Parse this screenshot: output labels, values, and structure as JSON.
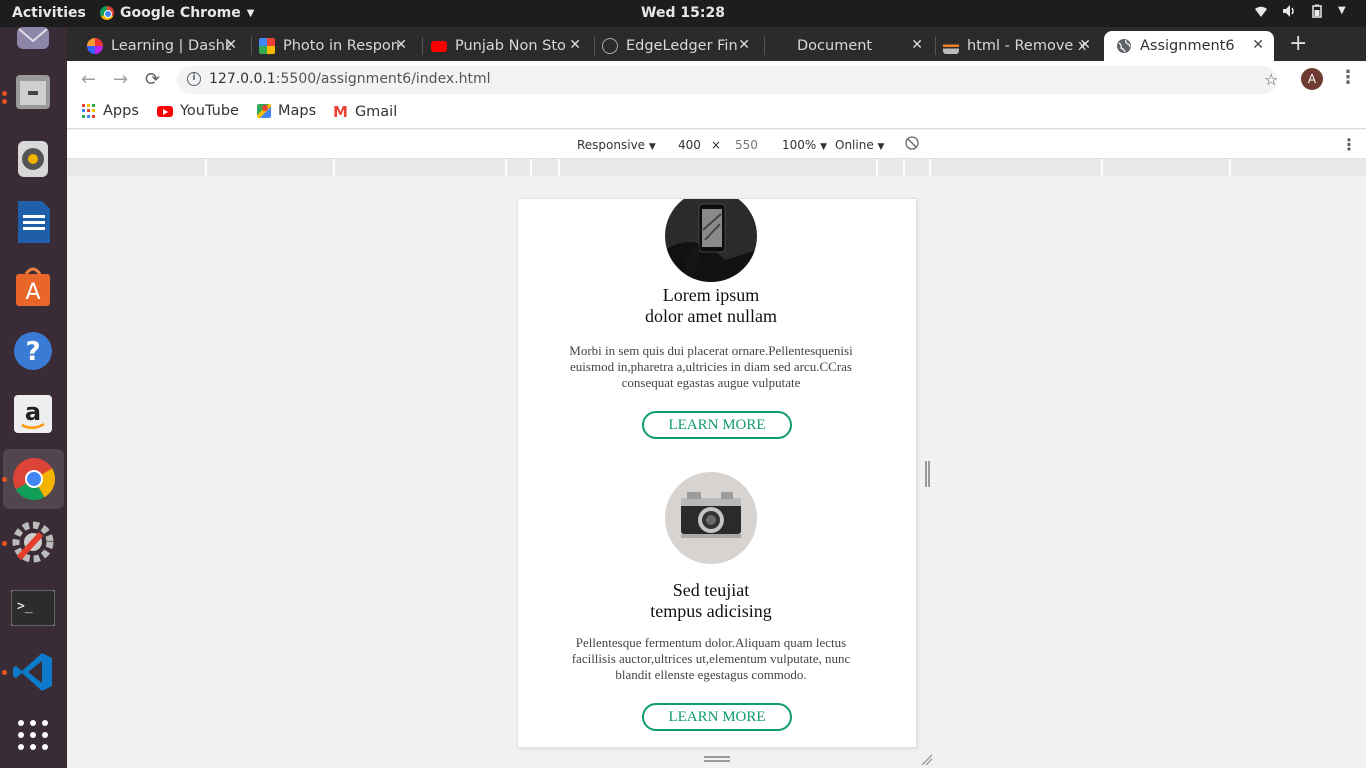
{
  "os": {
    "activities": "Activities",
    "app_name": "Google Chrome",
    "clock": "Wed 15:28"
  },
  "tabs": [
    {
      "title": "Learning | Dashb",
      "active": false
    },
    {
      "title": "Photo in Respon",
      "active": false
    },
    {
      "title": "Punjab Non Sto",
      "active": false
    },
    {
      "title": "EdgeLedger Fin",
      "active": false
    },
    {
      "title": "Document",
      "active": false
    },
    {
      "title": "html - Remove x",
      "active": false
    },
    {
      "title": "Assignment6",
      "active": true
    }
  ],
  "toolbar": {
    "url_host": "127.0.0.1",
    "url_rest": ":5500/assignment6/index.html",
    "avatar_letter": "A"
  },
  "bookmarks": [
    {
      "label": "Apps"
    },
    {
      "label": "YouTube"
    },
    {
      "label": "Maps"
    },
    {
      "label": "Gmail"
    }
  ],
  "devtools": {
    "device": "Responsive",
    "width": "400",
    "times": "×",
    "height": "550",
    "zoom": "100%",
    "network": "Online"
  },
  "page": {
    "cards": [
      {
        "title_line1": "Lorem ipsum",
        "title_line2": "dolor amet nullam",
        "body": "Morbi in sem quis dui placerat ornare.Pellentesquenisi euismod in,pharetra a,ultricies in diam sed arcu.CCras consequat egastas augue vulputate",
        "button": "LEARN MORE",
        "image": "phone-in-hand"
      },
      {
        "title_line1": "Sed teujiat",
        "title_line2": "tempus adicising",
        "body": "Pellentesque fermentum dolor.Aliquam quam lectus facillisis auctor,ultrices ut,elementum vulputate, nunc blandit ellenste egestagus commodo.",
        "button": "LEARN MORE",
        "image": "vintage-camera"
      }
    ],
    "accent_color": "#0f9d6b"
  }
}
